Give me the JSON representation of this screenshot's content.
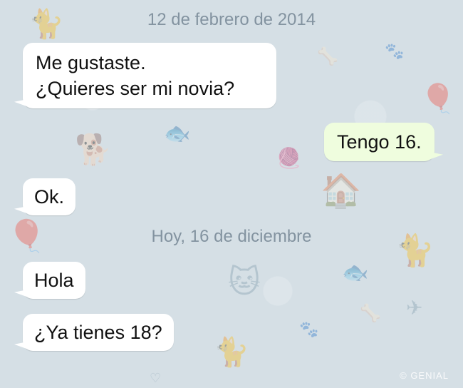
{
  "conversation": {
    "separators": [
      {
        "text": "12 de febrero de 2014"
      },
      {
        "text": "Hoy, 16 de diciembre"
      }
    ],
    "messages": [
      {
        "direction": "incoming",
        "lines": [
          "Me gustaste.",
          "¿Quieres ser mi novia?"
        ]
      },
      {
        "direction": "outgoing",
        "text": "Tengo 16."
      },
      {
        "direction": "incoming",
        "text": "Ok."
      },
      {
        "direction": "incoming",
        "text": "Hola"
      },
      {
        "direction": "incoming",
        "text": "¿Ya tienes 18?"
      }
    ]
  },
  "watermark": "© GENIAL",
  "colors": {
    "background": "#d5dfe5",
    "incoming_bubble": "#ffffff",
    "outgoing_bubble": "#effdde",
    "separator_text": "#8393a0"
  }
}
